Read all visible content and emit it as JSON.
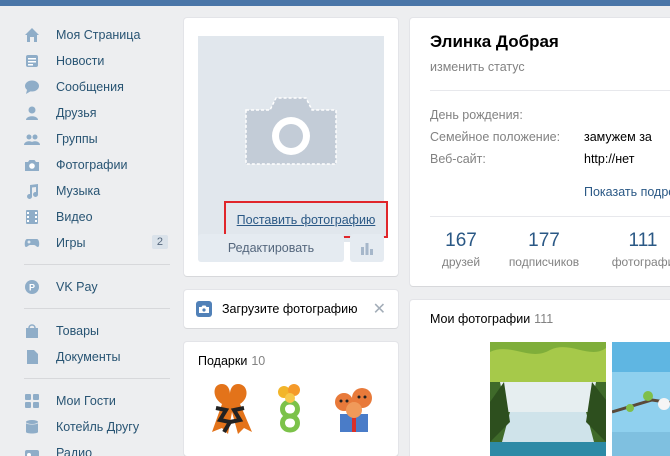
{
  "sidebar": {
    "items": [
      {
        "label": "Моя Страница",
        "icon": "home-icon"
      },
      {
        "label": "Новости",
        "icon": "news-icon"
      },
      {
        "label": "Сообщения",
        "icon": "messages-icon"
      },
      {
        "label": "Друзья",
        "icon": "friends-icon"
      },
      {
        "label": "Группы",
        "icon": "groups-icon"
      },
      {
        "label": "Фотографии",
        "icon": "camera-icon"
      },
      {
        "label": "Музыка",
        "icon": "music-icon"
      },
      {
        "label": "Видео",
        "icon": "video-icon"
      },
      {
        "label": "Игры",
        "icon": "gamepad-icon",
        "badge": "2"
      }
    ],
    "pay": {
      "label": "VK Pay",
      "icon": "vkpay-icon"
    },
    "extra": [
      {
        "label": "Товары",
        "icon": "bag-icon"
      },
      {
        "label": "Документы",
        "icon": "document-icon"
      }
    ],
    "apps": [
      {
        "label": "Мои Гости",
        "icon": "apps-icon"
      },
      {
        "label": "Котейль Другу",
        "icon": "database-icon"
      },
      {
        "label": "Радио",
        "icon": "radio-icon"
      }
    ]
  },
  "avatar": {
    "upload_label": "Поставить фотографию",
    "edit_label": "Редактировать"
  },
  "upload_prompt": {
    "text": "Загрузите фотографию",
    "close": "✕"
  },
  "gifts": {
    "title": "Подарки",
    "count": "10"
  },
  "profile": {
    "name": "Элинка Добрая",
    "status_label": "изменить статус",
    "info": [
      {
        "label": "День рождения:",
        "value": ""
      },
      {
        "label": "Семейное положение:",
        "value": "замужем за"
      },
      {
        "label": "Веб-сайт:",
        "value": "http://нет"
      }
    ],
    "details_link": "Показать подро",
    "counters": [
      {
        "num": "167",
        "label": "друзей"
      },
      {
        "num": "177",
        "label": "подписчиков"
      },
      {
        "num": "111",
        "label": "фотографи"
      }
    ]
  },
  "photos": {
    "title": "Мои фотографии",
    "count": "111"
  },
  "colors": {
    "accent": "#4a76a8",
    "link": "#2a5885",
    "highlight": "#e0262b"
  }
}
